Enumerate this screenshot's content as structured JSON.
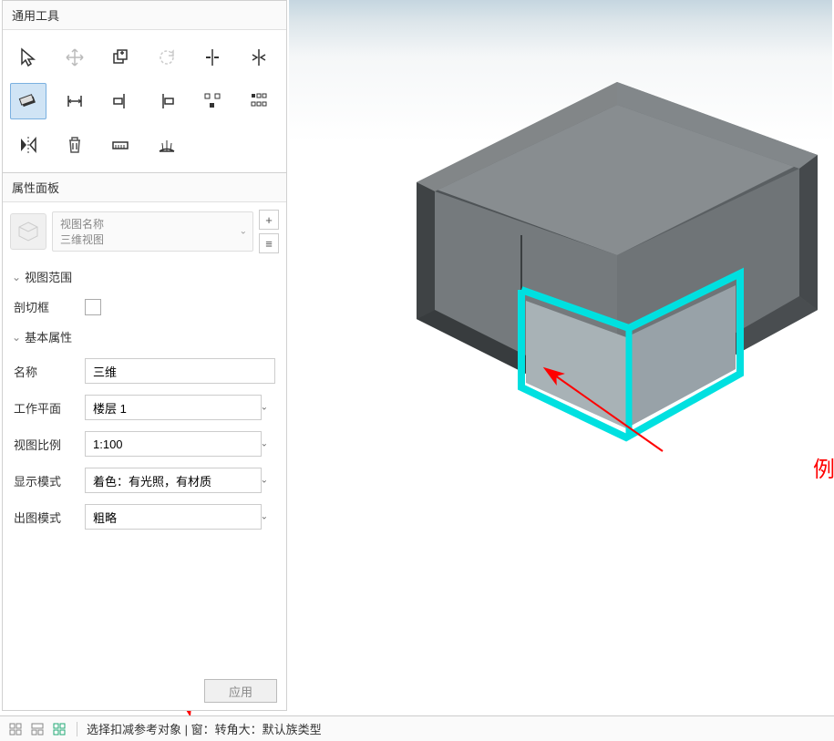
{
  "toolbox": {
    "title": "通用工具",
    "tools": [
      {
        "name": "select-arrow-icon"
      },
      {
        "name": "move-icon"
      },
      {
        "name": "copy-icon"
      },
      {
        "name": "rotate-icon"
      },
      {
        "name": "align-center-icon"
      },
      {
        "name": "align-edge-icon"
      },
      {
        "name": "cut-tool-icon",
        "active": true
      },
      {
        "name": "dimension-h-icon"
      },
      {
        "name": "align-left-icon"
      },
      {
        "name": "align-right-icon"
      },
      {
        "name": "distribute-icon"
      },
      {
        "name": "array-icon"
      },
      {
        "name": "mirror-icon"
      },
      {
        "name": "delete-icon"
      },
      {
        "name": "measure-icon"
      },
      {
        "name": "protractor-icon"
      }
    ]
  },
  "properties": {
    "panel_title": "属性面板",
    "view_name_label": "视图名称",
    "view_name_value": "三维视图",
    "add_btn": "+",
    "list_btn": "≡",
    "sections": {
      "view_range": {
        "title": "视图范围",
        "clip_box_label": "剖切框"
      },
      "basic": {
        "title": "基本属性",
        "name_label": "名称",
        "name_value": "三维",
        "workplane_label": "工作平面",
        "workplane_value": "楼层 1",
        "scale_label": "视图比例",
        "scale_value": "1:100",
        "display_label": "显示模式",
        "display_value": "着色：有光照，有材质",
        "plot_label": "出图模式",
        "plot_value": "粗略"
      }
    },
    "apply_label": "应用"
  },
  "statusbar": {
    "text": "选择扣减参考对象 | 窗：转角大：默认族类型"
  },
  "annotation": {
    "text": "例如此处：选择窗"
  }
}
